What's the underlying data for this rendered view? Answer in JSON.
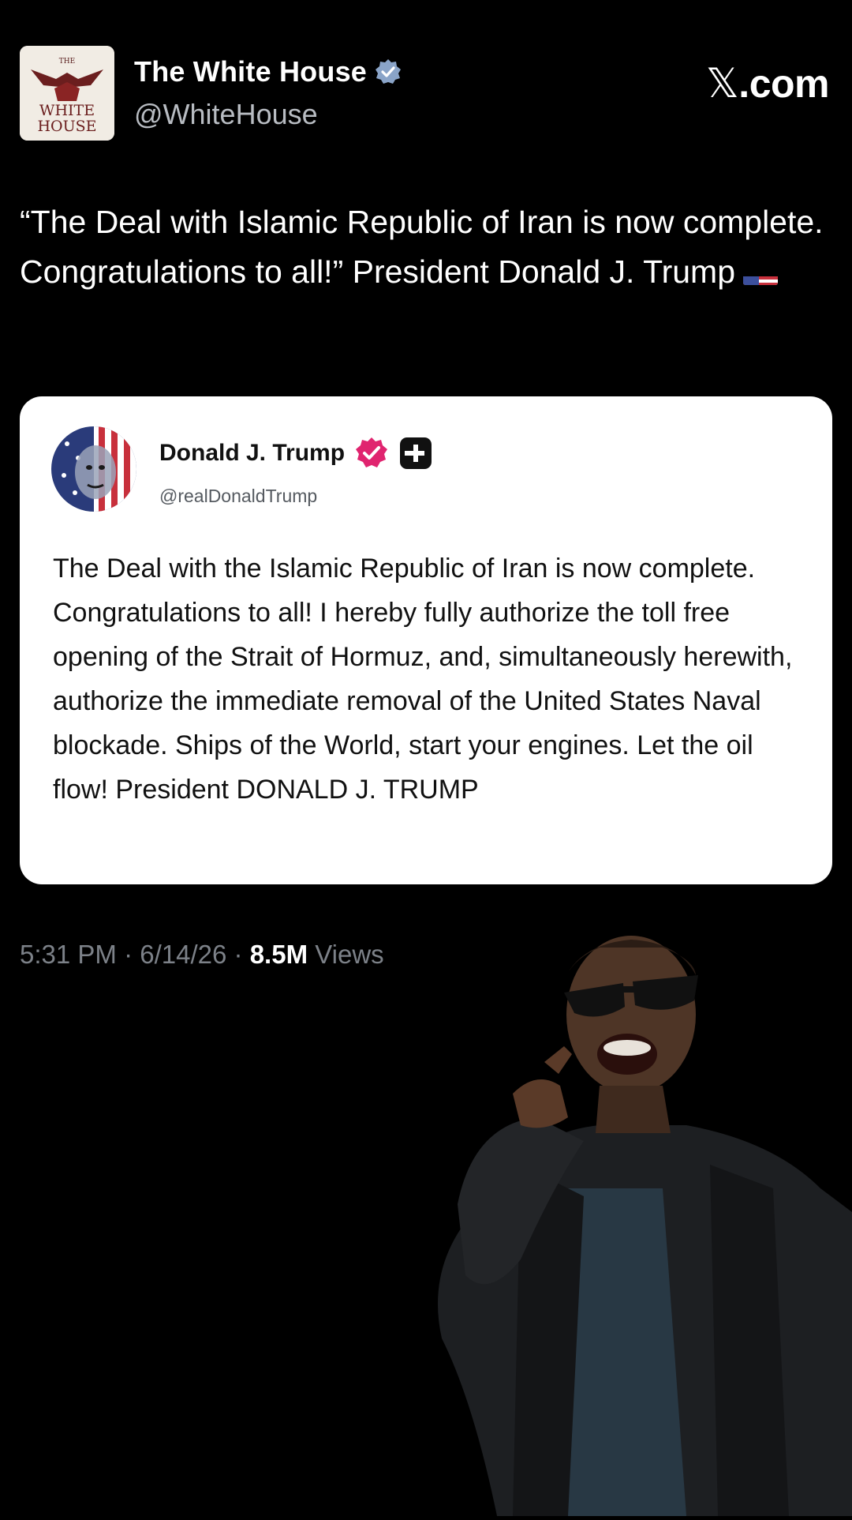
{
  "post": {
    "author_name": "The White House",
    "author_handle": "@WhiteHouse",
    "logo_text_top": "THE",
    "logo_text_mid": "WHITE",
    "logo_text_bottom": "HOUSE",
    "text": "“The Deal with Islamic Republic of Iran is now complete. Congratulations to all!” President Donald J. Trump",
    "flag_icon": "us-flag-emoji",
    "timestamp": "5:31 PM",
    "date": "6/14/26",
    "separator": "·",
    "views_count": "8.5M",
    "views_label": "Views"
  },
  "brand": {
    "x_glyph": "𝕏",
    "domain": ".com"
  },
  "quote": {
    "author_name": "Donald J. Trump",
    "author_handle": "@realDonaldTrump",
    "body": "The Deal with the Islamic Republic of Iran is now complete. Congratulations to all! I hereby fully authorize the toll free opening of the Strait of Hormuz, and, simultaneously herewith, authorize the immediate removal of the United States Naval blockade. Ships of the World, start your engines. Let the oil flow! President DONALD J. TRUMP",
    "verified_color": "#e0246f",
    "plus_badge_color": "#111111"
  },
  "colors": {
    "background": "#000000",
    "verified_blue": "#8aa4c8",
    "meta_gray": "#7c8188",
    "card_background": "#ffffff"
  }
}
